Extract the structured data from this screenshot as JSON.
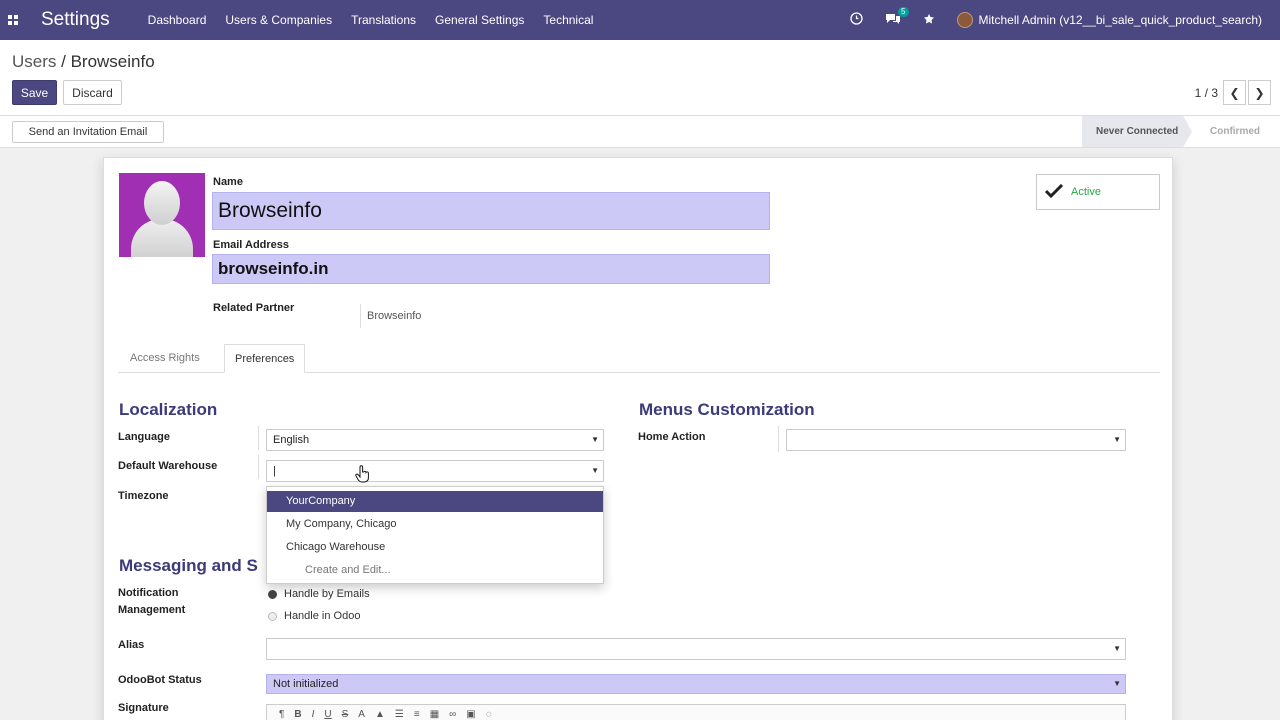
{
  "navbar": {
    "brand": "Settings",
    "menu": [
      "Dashboard",
      "Users & Companies",
      "Translations",
      "General Settings",
      "Technical"
    ],
    "chat_badge": "5",
    "user": "Mitchell Admin (v12__bi_sale_quick_product_search)",
    "icons": [
      "apps-icon",
      "clock-icon",
      "chat-icon",
      "settings-icon"
    ]
  },
  "control": {
    "breadcrumb_parent": "Users",
    "breadcrumb_sep": " / ",
    "breadcrumb_current": "Browseinfo",
    "save_label": "Save",
    "discard_label": "Discard",
    "pager": "1 / 3",
    "prev_glyph": "❮",
    "next_glyph": "❯"
  },
  "statusbar": {
    "invite_label": "Send an Invitation Email",
    "stages": [
      "Never Connected",
      "Confirmed"
    ],
    "active_stage": "Never Connected"
  },
  "form": {
    "name_label": "Name",
    "name_value": "Browseinfo",
    "email_label": "Email Address",
    "email_value": "browseinfo.in",
    "partner_label": "Related Partner",
    "partner_value": "Browseinfo",
    "active_label": "Active",
    "tabs": [
      "Access Rights",
      "Preferences"
    ],
    "active_tab": "Preferences"
  },
  "preferences": {
    "localization_title": "Localization",
    "language_label": "Language",
    "language_value": "English",
    "warehouse_label": "Default Warehouse",
    "warehouse_value": "|",
    "timezone_label": "Timezone",
    "menus_title": "Menus Customization",
    "home_action_label": "Home Action",
    "home_action_value": "",
    "messaging_title": "Messaging and S",
    "notification_label_1": "Notification",
    "notification_label_2": "Management",
    "notification_options": [
      "Handle by Emails",
      "Handle in Odoo"
    ],
    "notification_selected": "Handle by Emails",
    "alias_label": "Alias",
    "alias_value": "",
    "odoobot_label": "OdooBot Status",
    "odoobot_value": "Not initialized",
    "signature_label": "Signature"
  },
  "warehouse_dropdown": {
    "options": [
      "YourCompany",
      "My Company, Chicago",
      "Chicago Warehouse"
    ],
    "highlighted": "YourCompany",
    "create_label": "Create and Edit..."
  },
  "colors": {
    "navbar": "#4b4780",
    "required_field": "#cdc9f7",
    "avatar_bg": "#a02fb4",
    "active_green": "#28a745"
  }
}
